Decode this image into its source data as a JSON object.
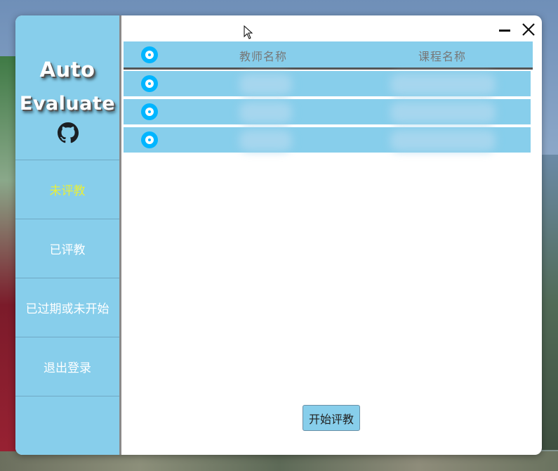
{
  "app": {
    "logo_line1": "Auto",
    "logo_line2": "Evaluate",
    "github_icon": "github-icon"
  },
  "sidebar": {
    "items": [
      {
        "label": "未评教",
        "active": true
      },
      {
        "label": "已评教",
        "active": false
      },
      {
        "label": "已过期或未开始",
        "active": false
      },
      {
        "label": "退出登录",
        "active": false
      }
    ]
  },
  "table": {
    "columns": [
      "教师名称",
      "课程名称"
    ],
    "rows": [
      {
        "teacher": "",
        "course": ""
      },
      {
        "teacher": "",
        "course": ""
      },
      {
        "teacher": "",
        "course": ""
      }
    ]
  },
  "actions": {
    "start_label": "开始评教"
  },
  "colors": {
    "panel": "#87ceeb",
    "active_nav": "#e8ef3a",
    "radio": "#00b5ff"
  }
}
